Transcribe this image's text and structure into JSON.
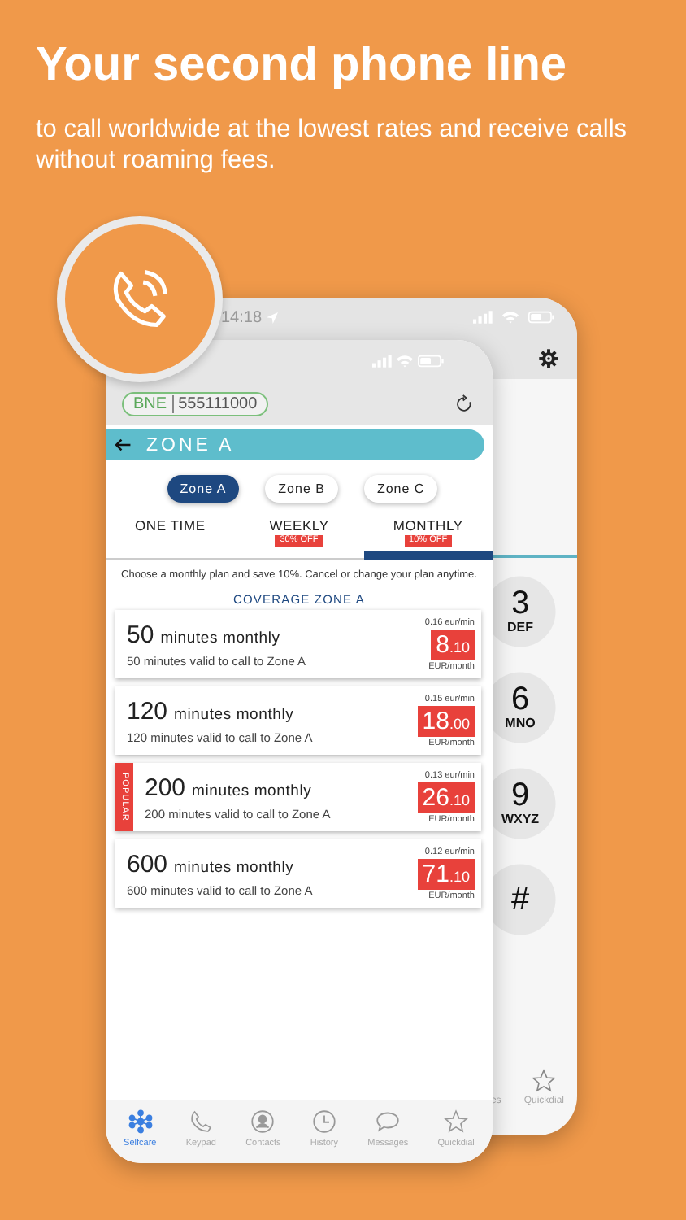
{
  "headline": "Your **second phone line**",
  "subtitle": "to call worldwide at the lowest rates and receive calls without roaming fees.",
  "back_phone": {
    "time": "14:18",
    "keys": [
      {
        "digit": "3",
        "letters": "DEF"
      },
      {
        "digit": "6",
        "letters": "MNO"
      },
      {
        "digit": "9",
        "letters": "WXYZ"
      },
      {
        "digit": "#"
      }
    ],
    "tabs": [
      {
        "label": "es",
        "kind": "text"
      },
      {
        "label": "Quickdial",
        "kind": "star"
      }
    ]
  },
  "front_phone": {
    "account": {
      "prefix": "BNE",
      "number": "555111000"
    },
    "title": "ZONE A",
    "zones": [
      {
        "label": "Zone A",
        "selected": true
      },
      {
        "label": "Zone B",
        "selected": false
      },
      {
        "label": "Zone C",
        "selected": false
      }
    ],
    "periods": [
      {
        "label": "ONE TIME",
        "selected": false
      },
      {
        "label": "WEEKLY",
        "badge": "30% OFF",
        "selected": false
      },
      {
        "label": "MONTHLY",
        "badge": "10% OFF",
        "selected": true
      }
    ],
    "note": "Choose a monthly plan and save 10%. Cancel or change your plan anytime.",
    "coverage": "COVERAGE ZONE A",
    "plans": [
      {
        "minutes": "50",
        "unit": "minutes monthly",
        "description": "50 minutes valid to call to Zone A",
        "rate": "0.16 eur/min",
        "price": "8",
        "cents": ".10",
        "per": "EUR/month"
      },
      {
        "minutes": "120",
        "unit": "minutes monthly",
        "description": "120 minutes valid to call to Zone A",
        "rate": "0.15 eur/min",
        "price": "18",
        "cents": ".00",
        "per": "EUR/month"
      },
      {
        "minutes": "200",
        "unit": "minutes monthly",
        "description": "200 minutes valid to call to Zone A",
        "rate": "0.13 eur/min",
        "price": "26",
        "cents": ".10",
        "per": "EUR/month",
        "ribbon": "POPULAR"
      },
      {
        "minutes": "600",
        "unit": "minutes monthly",
        "description": "600 minutes valid to call to Zone A",
        "rate": "0.12 eur/min",
        "price": "71",
        "cents": ".10",
        "per": "EUR/month"
      }
    ],
    "tabs": [
      {
        "label": "Selfcare",
        "kind": "network",
        "selected": true
      },
      {
        "label": "Keypad",
        "kind": "phone",
        "selected": false
      },
      {
        "label": "Contacts",
        "kind": "contact",
        "selected": false
      },
      {
        "label": "History",
        "kind": "clock",
        "selected": false
      },
      {
        "label": "Messages",
        "kind": "bubble",
        "selected": false
      },
      {
        "label": "Quickdial",
        "kind": "star",
        "selected": false
      }
    ]
  }
}
